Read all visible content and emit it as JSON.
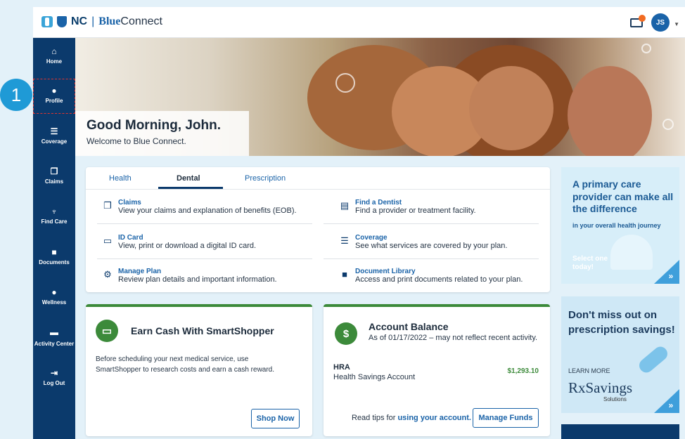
{
  "brand": {
    "nc": "NC",
    "separator": "|",
    "blue": "Blue",
    "connect": "Connect"
  },
  "header": {
    "avatar_initials": "JS",
    "notification_count": ""
  },
  "sidebar": {
    "items": [
      {
        "label": "Home",
        "icon": "home-icon"
      },
      {
        "label": "Profile",
        "icon": "person-icon"
      },
      {
        "label": "Coverage",
        "icon": "list-icon"
      },
      {
        "label": "Claims",
        "icon": "documents-icon"
      },
      {
        "label": "Find Care",
        "icon": "stethoscope-icon"
      },
      {
        "label": "Documents",
        "icon": "folder-icon"
      },
      {
        "label": "Wellness",
        "icon": "apple-icon"
      },
      {
        "label": "Activity Center",
        "icon": "card-icon"
      },
      {
        "label": "Log Out",
        "icon": "logout-icon"
      }
    ]
  },
  "annotation": {
    "step": "1"
  },
  "hero": {
    "title": "Good Morning, John.",
    "subtitle": "Welcome to Blue Connect."
  },
  "tabs": {
    "items": [
      "Health",
      "Dental",
      "Prescription"
    ],
    "active": "Dental"
  },
  "links": [
    {
      "title": "Claims",
      "desc": "View your claims and explanation of benefits (EOB)."
    },
    {
      "title": "Find a Dentist",
      "desc": "Find a provider or treatment facility."
    },
    {
      "title": "ID Card",
      "desc": "View, print or download a digital ID card."
    },
    {
      "title": "Coverage",
      "desc": "See what services are covered by your plan."
    },
    {
      "title": "Manage Plan",
      "desc": "Review plan details and important information."
    },
    {
      "title": "Document Library",
      "desc": "Access and print documents related to your plan."
    }
  ],
  "smartshopper": {
    "title": "Earn Cash With SmartShopper",
    "body": "Before scheduling your next medical service, use SmartShopper to research costs and earn a cash reward.",
    "button": "Shop Now"
  },
  "account": {
    "title": "Account Balance",
    "subtitle": "As of 01/17/2022 – may not reflect recent activity.",
    "hra_label": "HRA",
    "hra_name": "Health Savings Account",
    "amount": "$1,293.10",
    "tips_prefix": "Read tips for",
    "tips_link": "using your account.",
    "button": "Manage Funds"
  },
  "promo1": {
    "title": "A primary care provider can make all the difference",
    "subtitle": "in your overall health journey",
    "cta": "Select one today!",
    "arrow": "»"
  },
  "promo2": {
    "title": "Don't miss out on prescription savings!",
    "learn": "LEARN MORE",
    "rx": "RxSavings",
    "solutions": "Solutions",
    "arrow": "»"
  }
}
